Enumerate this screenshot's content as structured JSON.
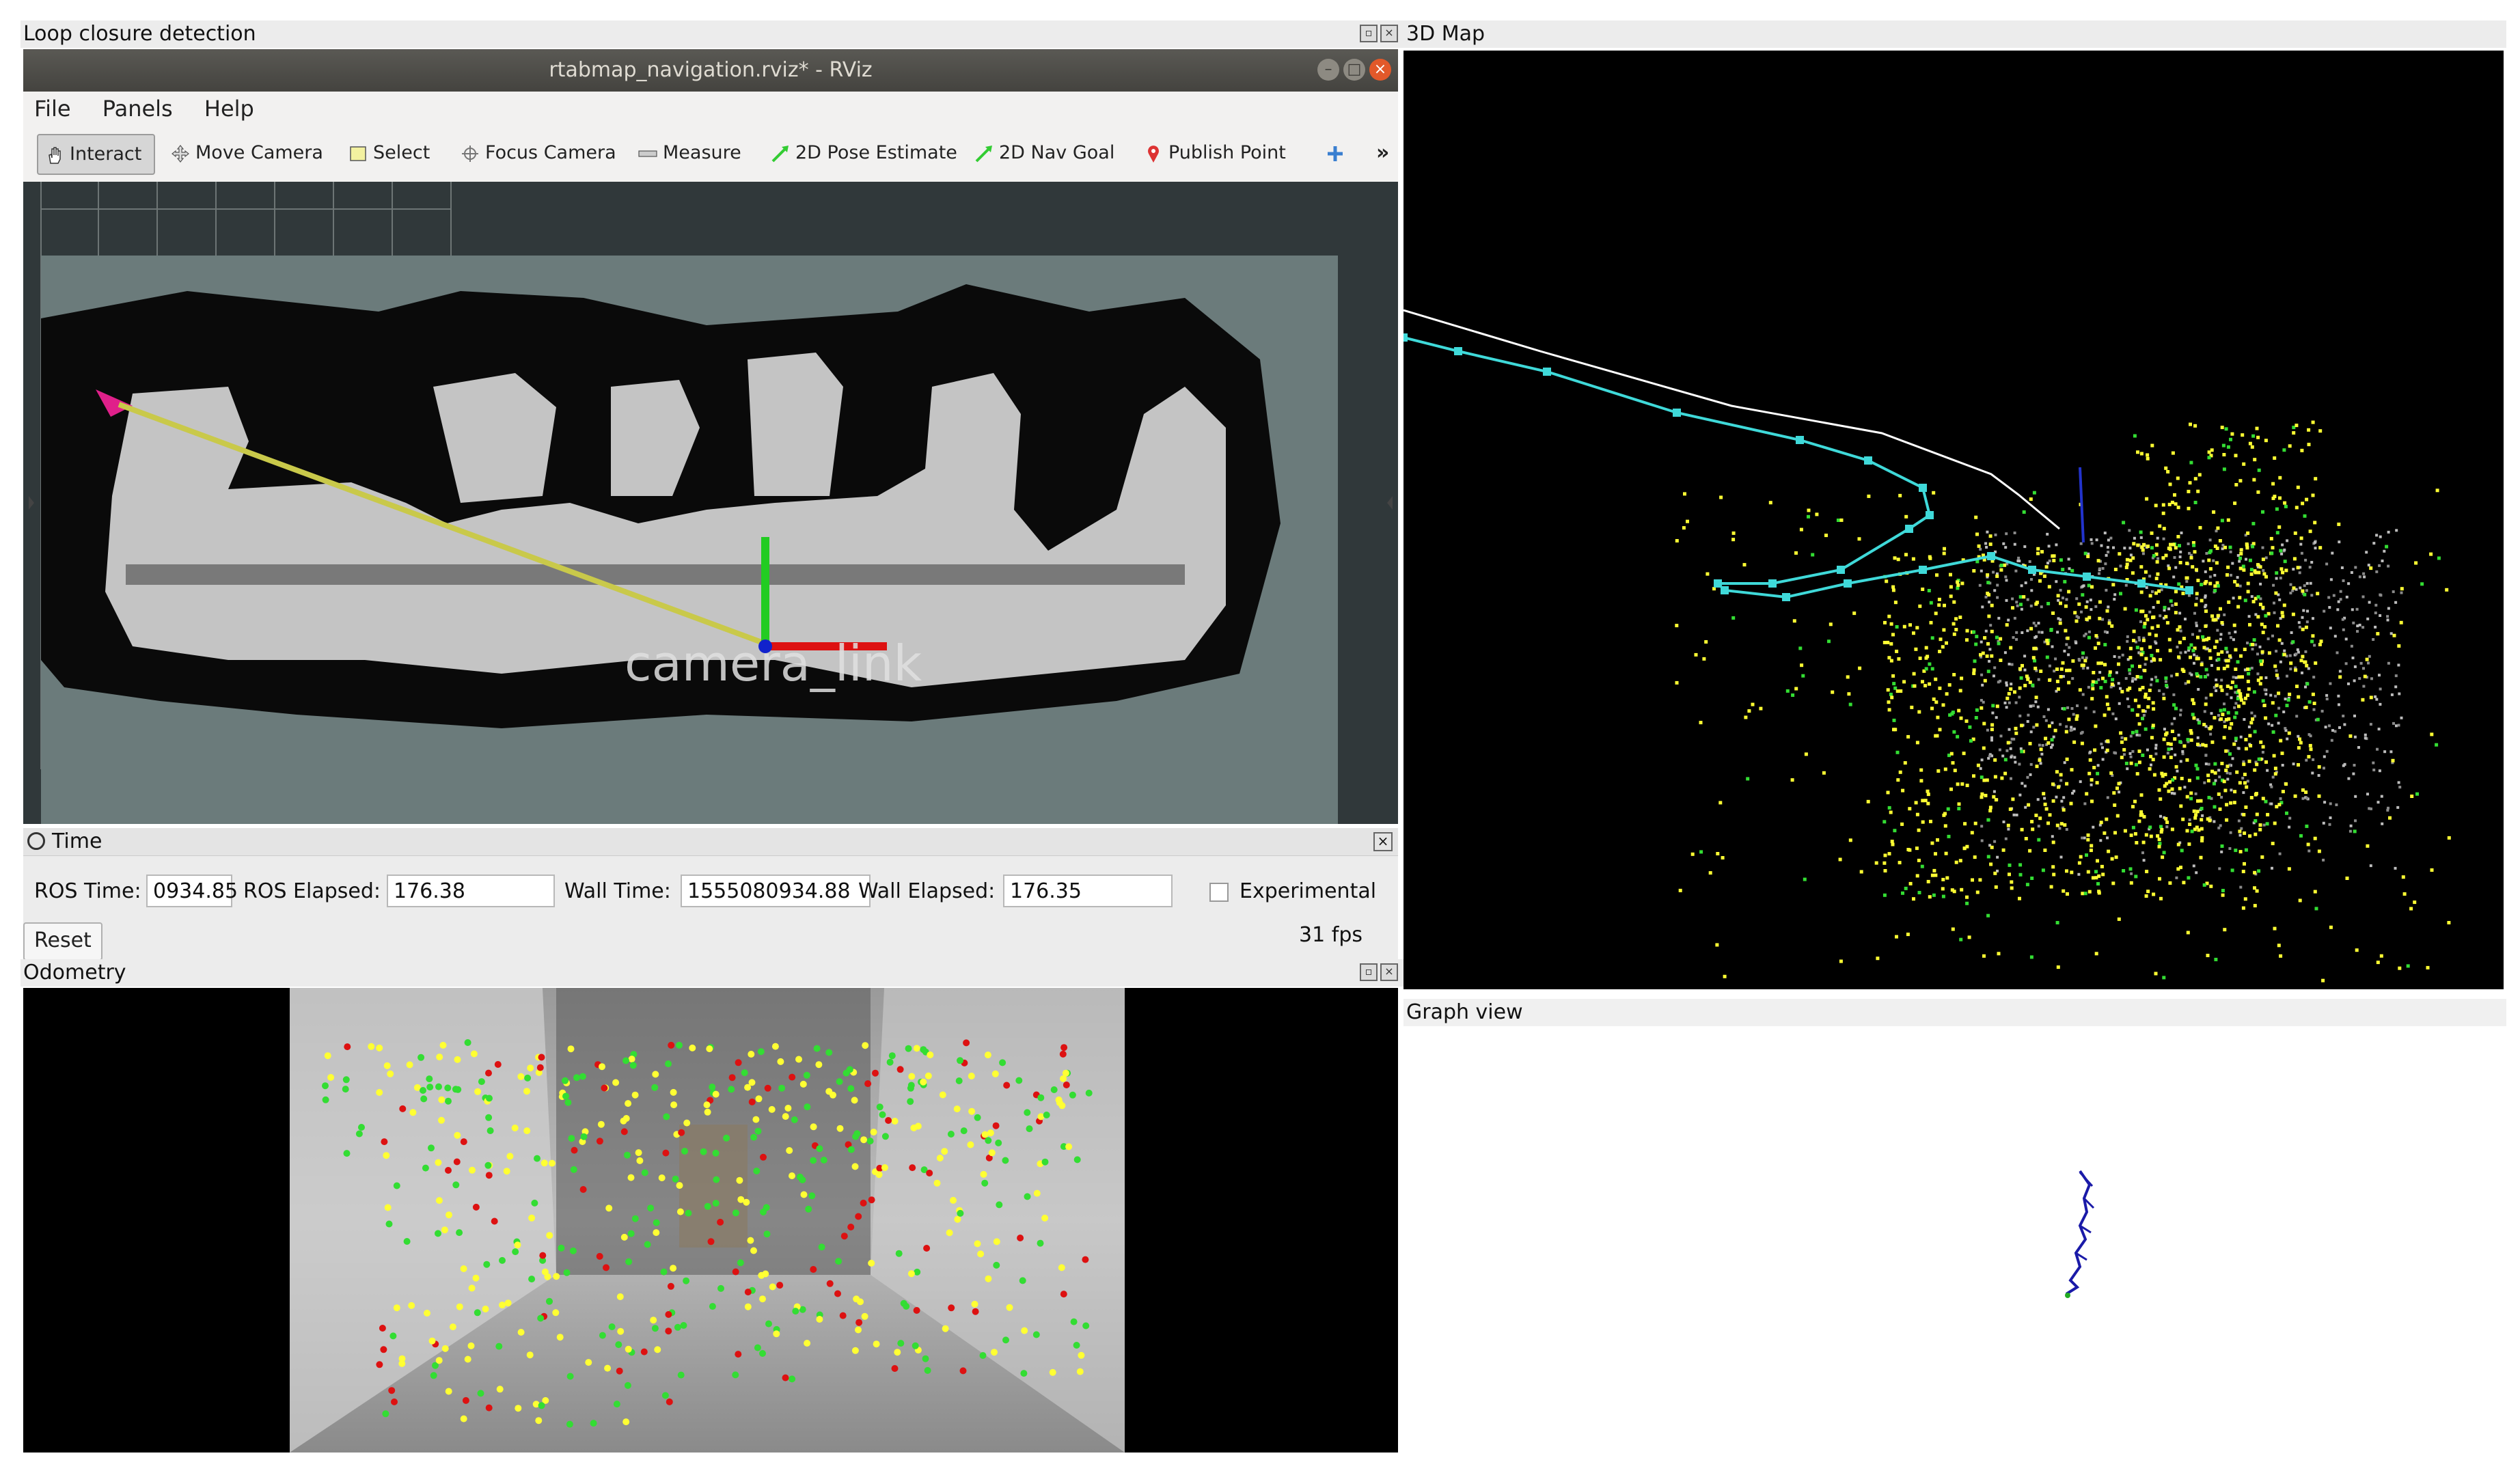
{
  "panels": {
    "loop_closure": "Loop closure detection",
    "map3d": "3D Map",
    "odometry": "Odometry",
    "graph_view": "Graph view"
  },
  "rviz": {
    "window_title": "rtabmap_navigation.rviz* - RViz",
    "menu": [
      "File",
      "Panels",
      "Help"
    ],
    "toolbar": [
      {
        "label": "Interact",
        "icon": "hand-icon",
        "active": true
      },
      {
        "label": "Move Camera",
        "icon": "move-camera-icon"
      },
      {
        "label": "Select",
        "icon": "select-icon"
      },
      {
        "label": "Focus Camera",
        "icon": "focus-camera-icon"
      },
      {
        "label": "Measure",
        "icon": "ruler-icon"
      },
      {
        "label": "2D Pose Estimate",
        "icon": "green-arrow-icon"
      },
      {
        "label": "2D Nav Goal",
        "icon": "green-arrow-icon"
      },
      {
        "label": "Publish Point",
        "icon": "map-pin-icon"
      }
    ],
    "viewport": {
      "frame_label": "camera_link"
    }
  },
  "time_panel": {
    "title": "Time",
    "ros_time_label": "ROS Time:",
    "ros_time_value": "0934.85",
    "ros_elapsed_label": "ROS Elapsed:",
    "ros_elapsed_value": "176.38",
    "wall_time_label": "Wall Time:",
    "wall_time_value": "1555080934.88",
    "wall_elapsed_label": "Wall Elapsed:",
    "wall_elapsed_value": "176.35",
    "experimental_label": "Experimental",
    "reset_label": "Reset",
    "fps": "31 fps"
  },
  "colors": {
    "map_free": "#c8c8c8",
    "map_unknown": "#697a7a",
    "trajectory": "#3fd9d9",
    "feature_yellow": "#ffff33",
    "feature_green": "#33dd33",
    "feature_red": "#dd1111",
    "graph_line": "#1a1aa8"
  }
}
